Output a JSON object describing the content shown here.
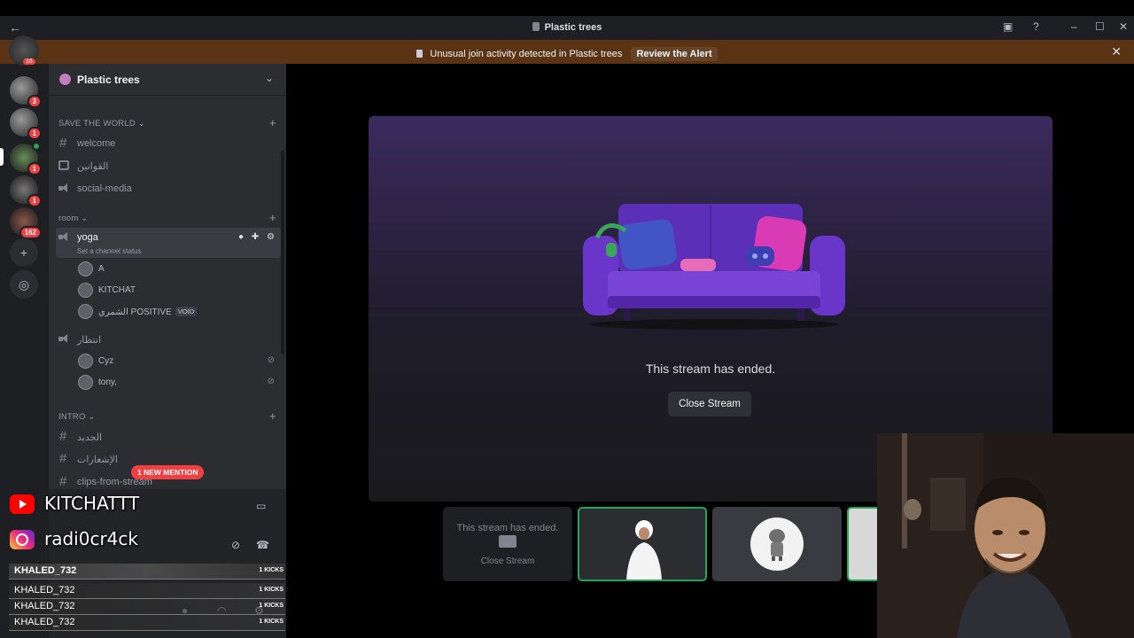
{
  "window": {
    "title": "Plastic trees"
  },
  "alert": {
    "text": "Unusual join activity detected in Plastic trees",
    "action": "Review the Alert"
  },
  "rail": {
    "servers": [
      {
        "badge": "3"
      },
      {
        "badge": "1"
      },
      {
        "badge": "1"
      },
      {
        "badge": "1"
      },
      {
        "badge": "162"
      }
    ],
    "top_badge": "16"
  },
  "server": {
    "name": "Plastic trees"
  },
  "categories": {
    "save_the_world": "SAVE THE WORLD",
    "room": "room",
    "intro": "INTRO"
  },
  "channels": {
    "welcome": "welcome",
    "rules": "القوانين",
    "social_media": "social-media",
    "yoga": "yoga",
    "yoga_status": "Set a channel status",
    "waiting": "انتظار",
    "new": "الجديد",
    "notifications": "الإشعارات",
    "clips": "clips-from-stream"
  },
  "voice_users": {
    "yoga": [
      "A",
      "KITCHAT",
      "الشمري POSITIVE"
    ],
    "yoga_tag": "VOID",
    "waiting": [
      "Cyz",
      "tony,"
    ]
  },
  "mention_badge": "1 NEW MENTION",
  "overlay": {
    "youtube": "KITCHATTT",
    "instagram": "radi0cr4ck"
  },
  "kicks": [
    {
      "name": "KHALED_732",
      "count": "1 KICKS"
    },
    {
      "name": "KHALED_732",
      "count": "1 KICKS"
    },
    {
      "name": "KHALED_732",
      "count": "1 KICKS"
    },
    {
      "name": "KHALED_732",
      "count": "1 KICKS"
    }
  ],
  "stream": {
    "ended_text": "This stream has ended.",
    "close_label": "Close Stream"
  },
  "tiles": {
    "ended_text": "This stream has ended.",
    "close_label": "Close Stream"
  }
}
